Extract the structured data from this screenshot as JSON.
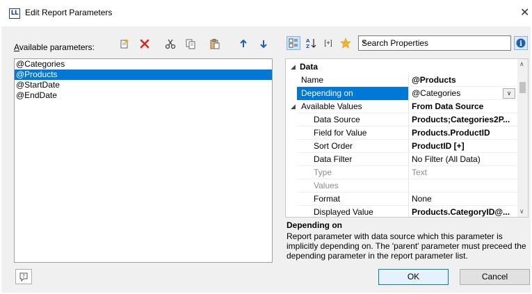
{
  "window": {
    "title": "Edit Report Parameters",
    "app_icon_text": "LL",
    "close_icon": "close-icon"
  },
  "left": {
    "available_label_accel": "A",
    "available_label_rest": "vailable parameters:",
    "toolbar": [
      {
        "icon": "new-parameter-icon"
      },
      {
        "icon": "delete-icon"
      },
      {
        "icon": "cut-icon"
      },
      {
        "icon": "copy-icon"
      },
      {
        "icon": "paste-icon"
      },
      {
        "icon": "arrow-up-icon"
      },
      {
        "icon": "arrow-down-icon"
      }
    ],
    "parameters": [
      "@Categories",
      "@Products",
      "@StartDate",
      "@EndDate"
    ],
    "selected_index": 1
  },
  "right": {
    "toolbar": [
      {
        "icon": "categorized-view-icon",
        "active": true
      },
      {
        "icon": "sort-alphabetical-icon"
      },
      {
        "icon": "expand-collapse-icon",
        "text": "[+]"
      },
      {
        "icon": "favorites-star-icon"
      }
    ],
    "search": {
      "value": "Search Properties"
    },
    "info_icon": "info-icon",
    "properties": [
      {
        "type": "category",
        "name": "Data",
        "level": 0
      },
      {
        "type": "prop",
        "name": "Name",
        "value": "@Products",
        "bold": true,
        "level": 1
      },
      {
        "type": "prop",
        "name": "Depending on",
        "value": "@Categories",
        "level": 1,
        "selected": true,
        "dropdown": true
      },
      {
        "type": "expand",
        "name": "Available Values",
        "value": "From Data Source",
        "bold": true,
        "level": 1
      },
      {
        "type": "prop",
        "name": "Data Source",
        "value": "Products;Categories2P...",
        "bold": true,
        "level": 2
      },
      {
        "type": "prop",
        "name": "Field for Value",
        "value": "Products.ProductID",
        "bold": true,
        "level": 2
      },
      {
        "type": "prop",
        "name": "Sort Order",
        "value": "ProductID [+]",
        "bold": true,
        "level": 2
      },
      {
        "type": "prop",
        "name": "Data Filter",
        "value": "No Filter (All Data)",
        "level": 2
      },
      {
        "type": "prop",
        "name": "Type",
        "value": "Text",
        "level": 2,
        "disabled": true
      },
      {
        "type": "prop",
        "name": "Values",
        "value": "",
        "level": 2,
        "disabled": true
      },
      {
        "type": "prop",
        "name": "Format",
        "value": "None",
        "level": 2
      },
      {
        "type": "prop",
        "name": "Displayed Value",
        "value": "Products.CategoryID@...",
        "bold": true,
        "level": 2
      }
    ],
    "description": {
      "title": "Depending on",
      "text": "Report parameter with data source which this parameter is implicitly depending on. The 'parent' parameter must preceed the depending parameter in the report parameter list."
    }
  },
  "buttons": {
    "ok": "OK",
    "cancel": "Cancel",
    "help_icon": "help-icon"
  }
}
